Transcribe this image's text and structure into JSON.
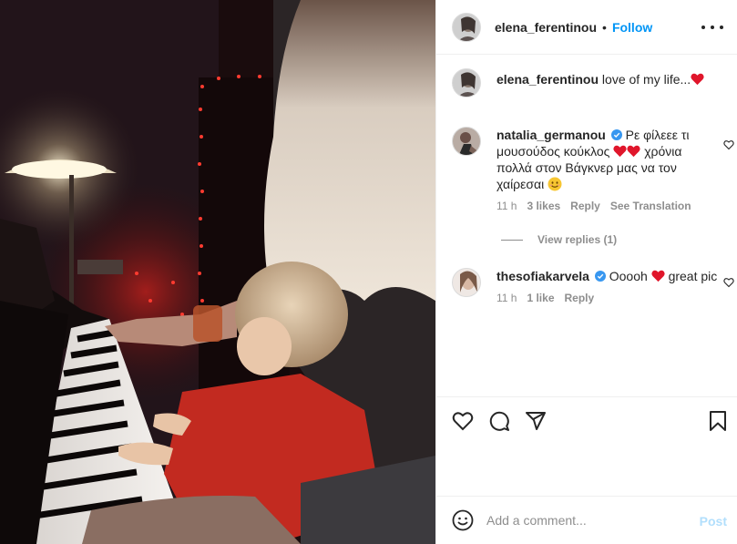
{
  "post": {
    "author": "elena_ferentinou",
    "follow_label": "Follow",
    "separator": "•",
    "more_icon": "more-options-icon"
  },
  "caption": {
    "username": "elena_ferentinou",
    "text": "love of my life...",
    "emoji": "red-heart"
  },
  "comments": [
    {
      "username": "natalia_germanou",
      "verified": true,
      "text_part1": "Ρε φίλεεε τι μουσούδος κούκλος",
      "text_part2": "χρόνια πολλά στον Βάγκνερ μας να τον χαίρεσαι",
      "time": "11 h",
      "likes": "3 likes",
      "reply_label": "Reply",
      "translate_label": "See Translation"
    },
    {
      "username": "thesofiakarvela",
      "verified": true,
      "text_part1": "Ooooh",
      "text_part2": "great pic",
      "time": "11 h",
      "likes": "1 like",
      "reply_label": "Reply"
    }
  ],
  "view_replies": "View replies (1)",
  "actions": {
    "like_icon": "heart-icon",
    "comment_icon": "comment-icon",
    "share_icon": "paper-plane-icon",
    "save_icon": "bookmark-icon"
  },
  "add_comment": {
    "placeholder": "Add a comment...",
    "post_label": "Post"
  },
  "colors": {
    "link_blue": "#0095f6",
    "post_disabled": "#b2dffc",
    "heart_red": "#ed4956",
    "muted_text": "#8e8e8e"
  }
}
